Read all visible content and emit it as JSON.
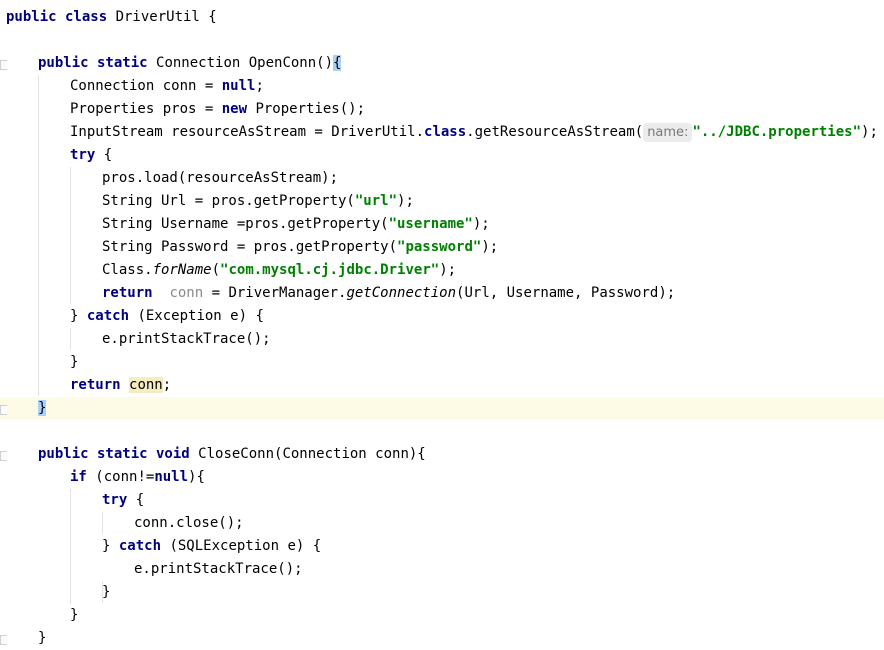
{
  "editor": {
    "lines": [
      {
        "indent": 0,
        "caret": false,
        "tokens": [
          {
            "t": "public class ",
            "c": "kw"
          },
          {
            "t": "DriverUtil {",
            "c": ""
          }
        ]
      },
      {
        "indent": 0,
        "caret": false,
        "tokens": []
      },
      {
        "indent": 1,
        "caret": false,
        "fold": true,
        "tokens": [
          {
            "t": "public static ",
            "c": "kw"
          },
          {
            "t": "Connection OpenConn()",
            "c": ""
          },
          {
            "t": "{",
            "c": "brace-hl"
          }
        ]
      },
      {
        "indent": 2,
        "caret": false,
        "tokens": [
          {
            "t": "Connection conn = ",
            "c": ""
          },
          {
            "t": "null",
            "c": "kw"
          },
          {
            "t": ";",
            "c": ""
          }
        ]
      },
      {
        "indent": 2,
        "caret": false,
        "tokens": [
          {
            "t": "Properties pros = ",
            "c": ""
          },
          {
            "t": "new ",
            "c": "kw"
          },
          {
            "t": "Properties();",
            "c": ""
          }
        ]
      },
      {
        "indent": 2,
        "caret": false,
        "tokens": [
          {
            "t": "InputStream resourceAsStream = DriverUtil.",
            "c": ""
          },
          {
            "t": "class",
            "c": "kw"
          },
          {
            "t": ".getResourceAsStream(",
            "c": ""
          },
          {
            "t": "name:",
            "c": "hint"
          },
          {
            "t": "\"../JDBC.properties\"",
            "c": "str"
          },
          {
            "t": ");",
            "c": ""
          }
        ]
      },
      {
        "indent": 2,
        "caret": false,
        "tokens": [
          {
            "t": "try ",
            "c": "kw"
          },
          {
            "t": "{",
            "c": ""
          }
        ]
      },
      {
        "indent": 3,
        "caret": false,
        "tokens": [
          {
            "t": "pros.load(resourceAsStream);",
            "c": ""
          }
        ]
      },
      {
        "indent": 3,
        "caret": false,
        "tokens": [
          {
            "t": "String Url = pros.getProperty(",
            "c": ""
          },
          {
            "t": "\"url\"",
            "c": "str"
          },
          {
            "t": ");",
            "c": ""
          }
        ]
      },
      {
        "indent": 3,
        "caret": false,
        "tokens": [
          {
            "t": "String Username =pros.getProperty(",
            "c": ""
          },
          {
            "t": "\"username\"",
            "c": "str"
          },
          {
            "t": ");",
            "c": ""
          }
        ]
      },
      {
        "indent": 3,
        "caret": false,
        "tokens": [
          {
            "t": "String Password = pros.getProperty(",
            "c": ""
          },
          {
            "t": "\"password\"",
            "c": "str"
          },
          {
            "t": ");",
            "c": ""
          }
        ]
      },
      {
        "indent": 3,
        "caret": false,
        "tokens": [
          {
            "t": "Class.",
            "c": ""
          },
          {
            "t": "forName",
            "c": "it"
          },
          {
            "t": "(",
            "c": ""
          },
          {
            "t": "\"com.mysql.cj.jdbc.Driver\"",
            "c": "str"
          },
          {
            "t": ");",
            "c": ""
          }
        ]
      },
      {
        "indent": 3,
        "caret": false,
        "tokens": [
          {
            "t": "return  ",
            "c": "kw"
          },
          {
            "t": "conn",
            "c": "hint-var"
          },
          {
            "t": " = DriverManager.",
            "c": ""
          },
          {
            "t": "getConnection",
            "c": "it"
          },
          {
            "t": "(Url, Username, Password);",
            "c": ""
          }
        ]
      },
      {
        "indent": 2,
        "caret": false,
        "tokens": [
          {
            "t": "} ",
            "c": ""
          },
          {
            "t": "catch ",
            "c": "kw"
          },
          {
            "t": "(Exception e) {",
            "c": ""
          }
        ]
      },
      {
        "indent": 3,
        "caret": false,
        "tokens": [
          {
            "t": "e.printStackTrace();",
            "c": ""
          }
        ]
      },
      {
        "indent": 2,
        "caret": false,
        "tokens": [
          {
            "t": "}",
            "c": ""
          }
        ]
      },
      {
        "indent": 2,
        "caret": false,
        "tokens": [
          {
            "t": "return ",
            "c": "kw"
          },
          {
            "t": "conn",
            "c": "word-hl"
          },
          {
            "t": ";",
            "c": ""
          }
        ]
      },
      {
        "indent": 1,
        "caret": true,
        "fold": true,
        "tokens": [
          {
            "t": "}",
            "c": "brace-hl"
          }
        ]
      },
      {
        "indent": 0,
        "caret": false,
        "tokens": []
      },
      {
        "indent": 1,
        "caret": false,
        "fold": true,
        "tokens": [
          {
            "t": "public static void ",
            "c": "kw"
          },
          {
            "t": "CloseConn(Connection conn){",
            "c": ""
          }
        ]
      },
      {
        "indent": 2,
        "caret": false,
        "tokens": [
          {
            "t": "if ",
            "c": "kw"
          },
          {
            "t": "(conn!=",
            "c": ""
          },
          {
            "t": "null",
            "c": "kw"
          },
          {
            "t": "){",
            "c": ""
          }
        ]
      },
      {
        "indent": 3,
        "caret": false,
        "tokens": [
          {
            "t": "try ",
            "c": "kw"
          },
          {
            "t": "{",
            "c": ""
          }
        ]
      },
      {
        "indent": 4,
        "caret": false,
        "tokens": [
          {
            "t": "conn.close();",
            "c": ""
          }
        ]
      },
      {
        "indent": 3,
        "caret": false,
        "tokens": [
          {
            "t": "} ",
            "c": ""
          },
          {
            "t": "catch ",
            "c": "kw"
          },
          {
            "t": "(SQLException e) {",
            "c": ""
          }
        ]
      },
      {
        "indent": 4,
        "caret": false,
        "tokens": [
          {
            "t": "e.printStackTrace();",
            "c": ""
          }
        ]
      },
      {
        "indent": 3,
        "caret": false,
        "tokens": [
          {
            "t": "}",
            "c": ""
          }
        ]
      },
      {
        "indent": 2,
        "caret": false,
        "tokens": [
          {
            "t": "}",
            "c": ""
          }
        ]
      },
      {
        "indent": 1,
        "caret": false,
        "fold": true,
        "tokens": [
          {
            "t": "}",
            "c": ""
          }
        ]
      }
    ]
  },
  "colors": {
    "keyword": "#000080",
    "string": "#008000",
    "caret_line": "#fdfbe6",
    "brace_match": "#a9d1f7",
    "usage_highlight": "#f5ecc2"
  }
}
